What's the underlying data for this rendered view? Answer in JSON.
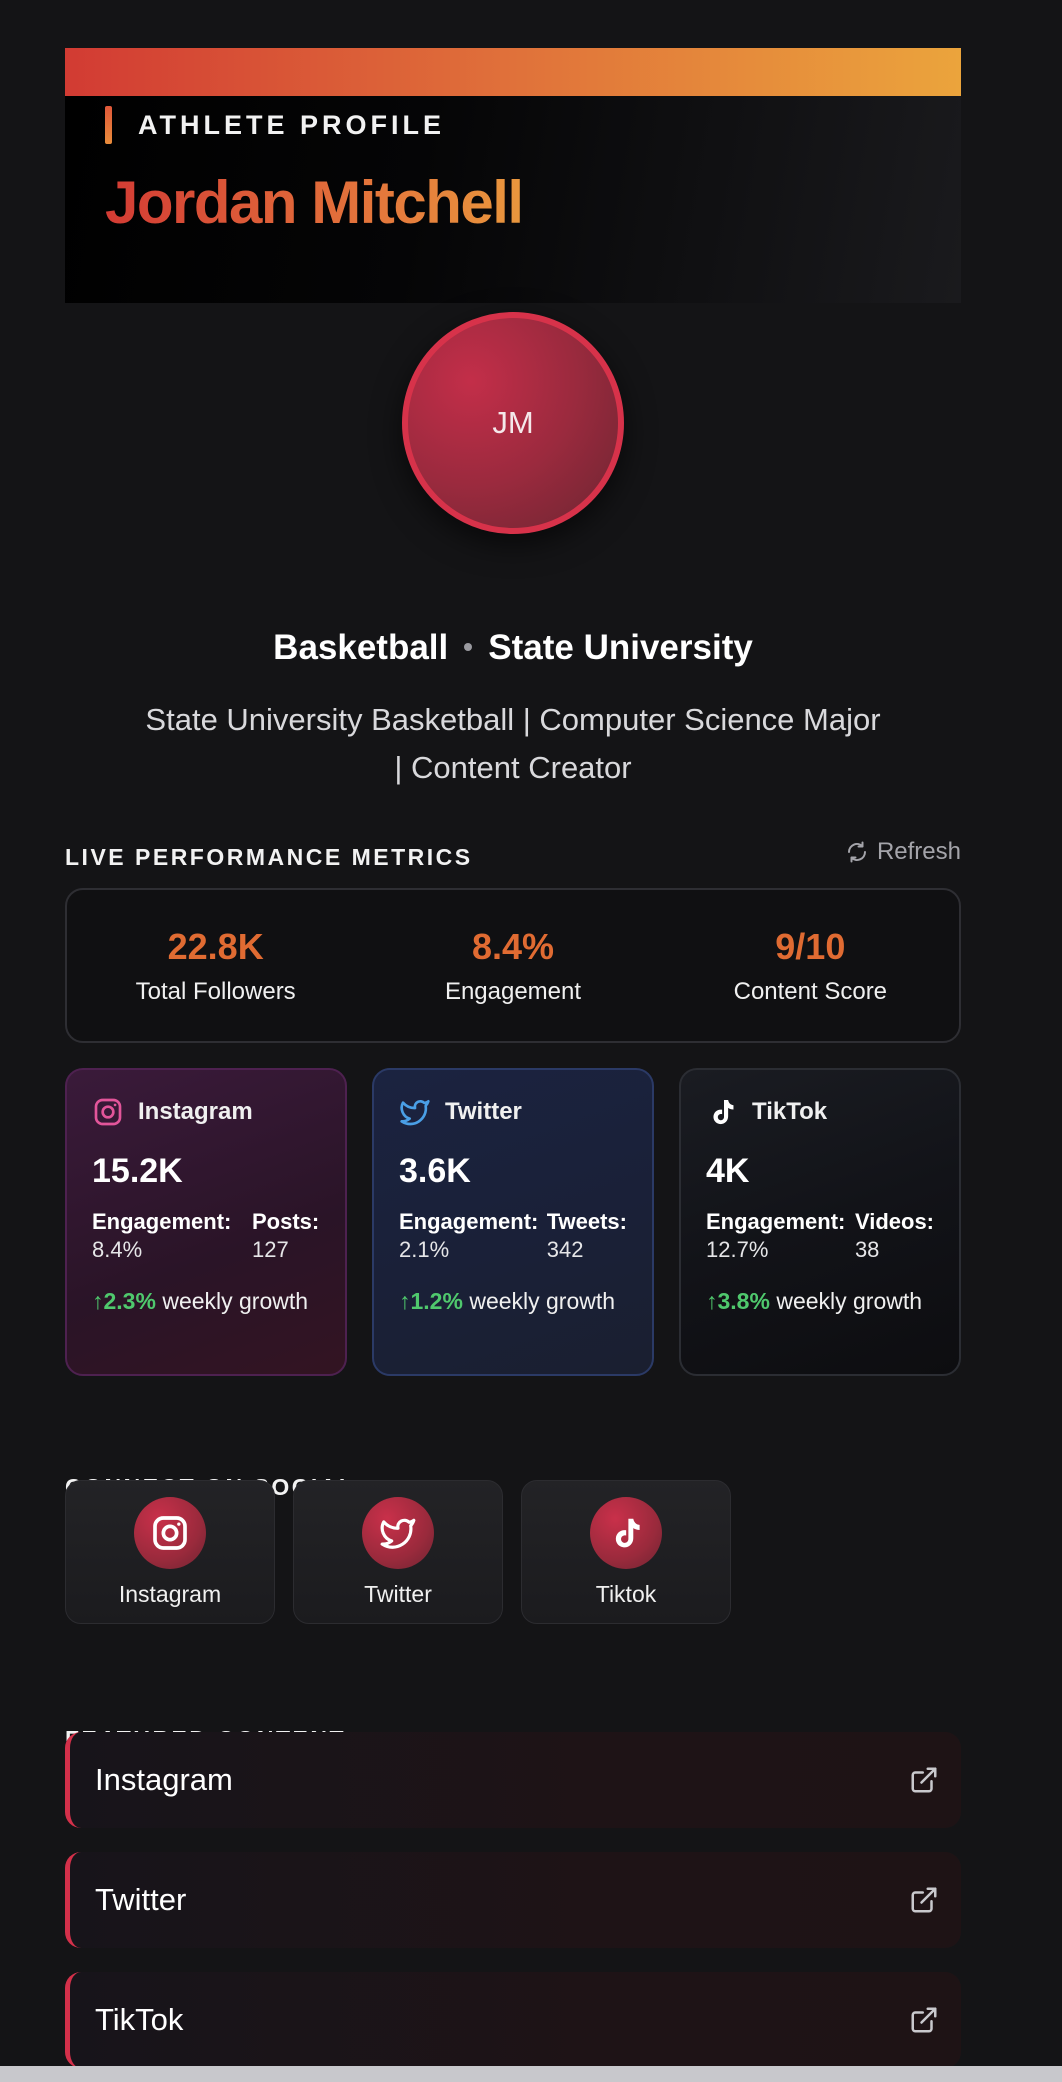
{
  "header": {
    "kicker": "ATHLETE PROFILE",
    "name": "Jordan Mitchell"
  },
  "avatar": {
    "initials": "JM"
  },
  "profile": {
    "sport": "Basketball",
    "school": "State University",
    "bio": "State University Basketball | Computer Science Major | Content Creator"
  },
  "metrics": {
    "title": "LIVE PERFORMANCE METRICS",
    "refresh_label": "Refresh",
    "items": [
      {
        "value": "22.8K",
        "label": "Total Followers"
      },
      {
        "value": "8.4%",
        "label": "Engagement"
      },
      {
        "value": "9/10",
        "label": "Content Score"
      }
    ]
  },
  "platforms": [
    {
      "name": "Instagram",
      "count": "15.2K",
      "stat1_label": "Engagement:",
      "stat1_value": "8.4%",
      "stat2_label": "Posts:",
      "stat2_value": "127",
      "growth": "↑2.3%",
      "growth_suffix": " weekly growth"
    },
    {
      "name": "Twitter",
      "count": "3.6K",
      "stat1_label": "Engagement:",
      "stat1_value": "2.1%",
      "stat2_label": "Tweets:",
      "stat2_value": "342",
      "growth": "↑1.2%",
      "growth_suffix": " weekly growth"
    },
    {
      "name": "TikTok",
      "count": "4K",
      "stat1_label": "Engagement:",
      "stat1_value": "12.7%",
      "stat2_label": "Videos:",
      "stat2_value": "38",
      "growth": "↑3.8%",
      "growth_suffix": " weekly growth"
    }
  ],
  "social": {
    "title": "CONNECT ON SOCIAL",
    "items": [
      {
        "label": "Instagram",
        "icon": "instagram-icon"
      },
      {
        "label": "Twitter",
        "icon": "twitter-icon"
      },
      {
        "label": "Tiktok",
        "icon": "tiktok-icon"
      }
    ]
  },
  "featured": {
    "title": "FEATURED CONTENT",
    "items": [
      {
        "label": "Instagram",
        "icon": "external-link-icon"
      },
      {
        "label": "Twitter",
        "icon": "external-link-icon"
      },
      {
        "label": "TikTok",
        "icon": "external-link-icon"
      }
    ]
  },
  "colors": {
    "accent_orange": "#e06b32",
    "accent_red": "#d4304a",
    "growth_green": "#4fc86d"
  }
}
